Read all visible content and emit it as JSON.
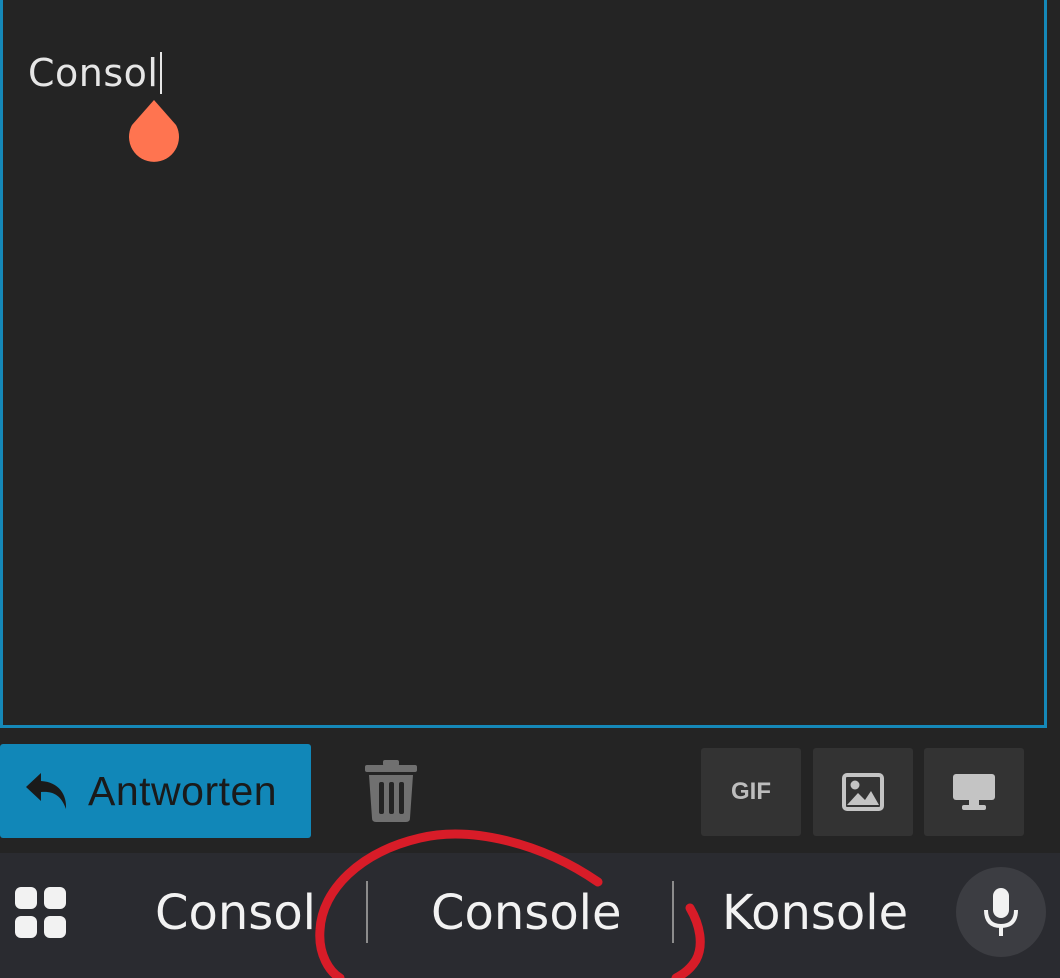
{
  "editor": {
    "text": "Consol"
  },
  "toolbar": {
    "reply_label": "Antworten",
    "gif_label": "GIF",
    "icons": [
      "reply-arrow-icon",
      "trash-icon",
      "image-icon",
      "monitor-icon"
    ]
  },
  "keyboard": {
    "suggestions": [
      "Consol",
      "Console",
      "Konsole"
    ],
    "icons": [
      "apps-grid-icon",
      "microphone-icon"
    ]
  },
  "colors": {
    "editor_border": "#1588b8",
    "reply_button": "#1187b8",
    "cursor_handle": "#ff7450",
    "annotation": "#d81c28"
  }
}
